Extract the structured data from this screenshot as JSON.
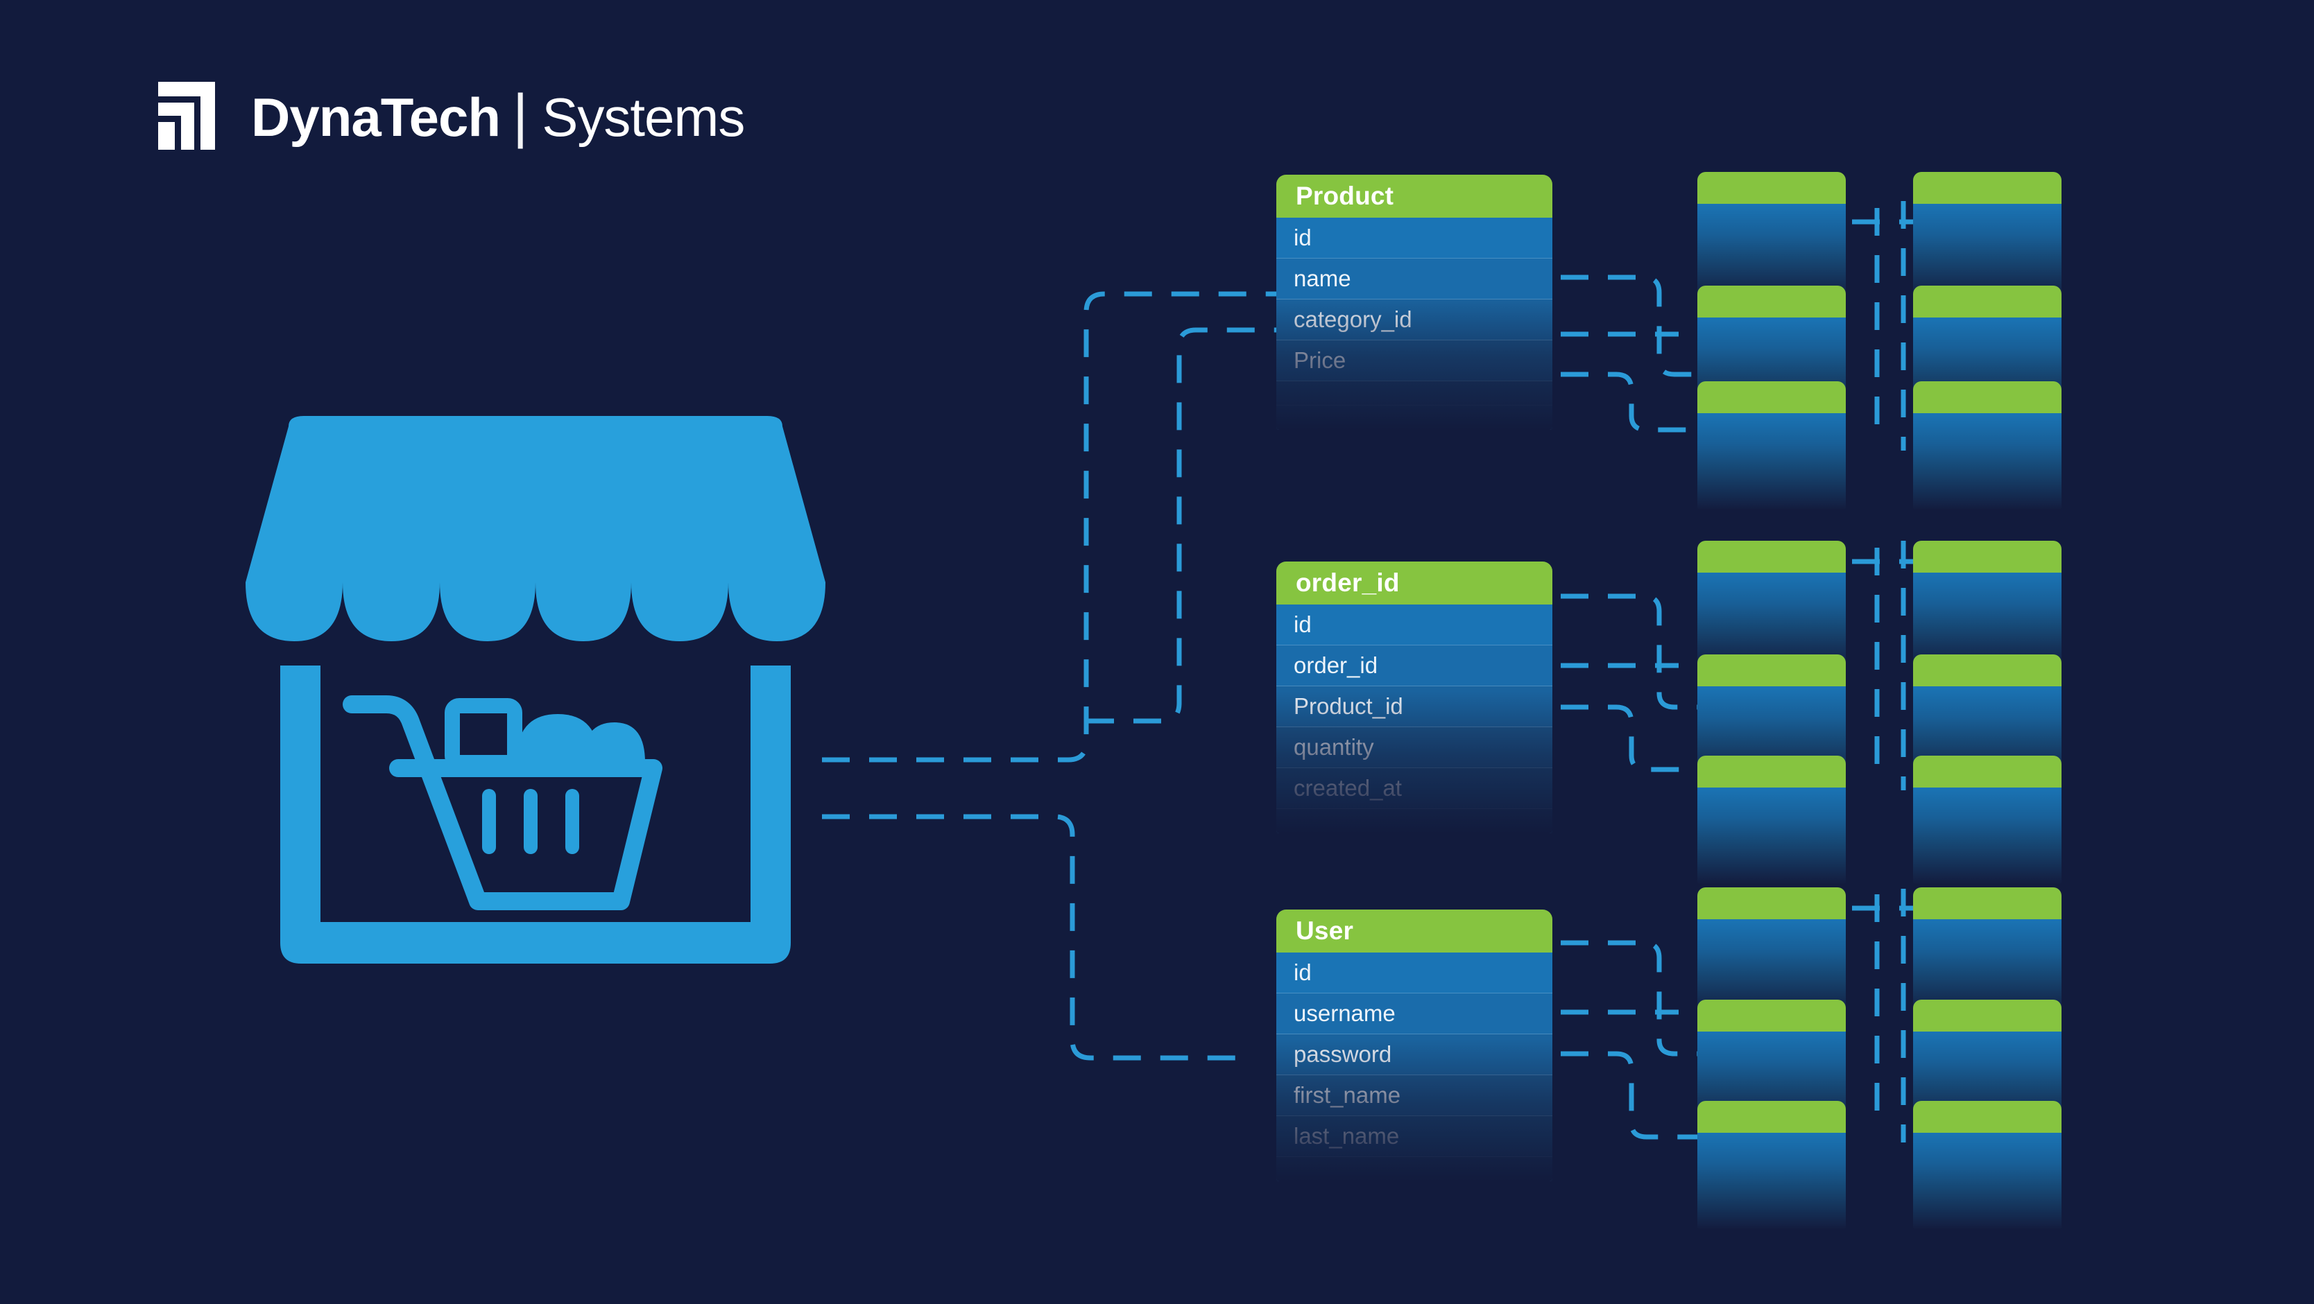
{
  "background_color": "#121b3d",
  "accent_green": "#86c440",
  "accent_blue": "#2b9bd8",
  "row_blue": "#1a74b5",
  "brand": {
    "mark_icon": "bar-chart-logo-icon",
    "name_bold": "DynaTech",
    "separator": "|",
    "name_light": "Systems"
  },
  "hero": {
    "icon": "storefront-shopping-cart-icon",
    "alt": "Online store front with shopping cart"
  },
  "tables": [
    {
      "title": "Product",
      "rows": [
        "id",
        "name",
        "category_id",
        "Price"
      ]
    },
    {
      "title": "order_id",
      "rows": [
        "id",
        "order_id",
        "Product_id",
        "quantity",
        "created_at"
      ]
    },
    {
      "title": "User",
      "rows": [
        "id",
        "username",
        "password",
        "first_name",
        "last_name"
      ]
    }
  ],
  "ghost_tables": {
    "label": "related-table-placeholder",
    "columns": 2,
    "rows_per_group": 3,
    "groups": 3,
    "total": 18
  },
  "connectors": {
    "style": "dashed",
    "color": "#2b9bd8",
    "count": 14
  }
}
